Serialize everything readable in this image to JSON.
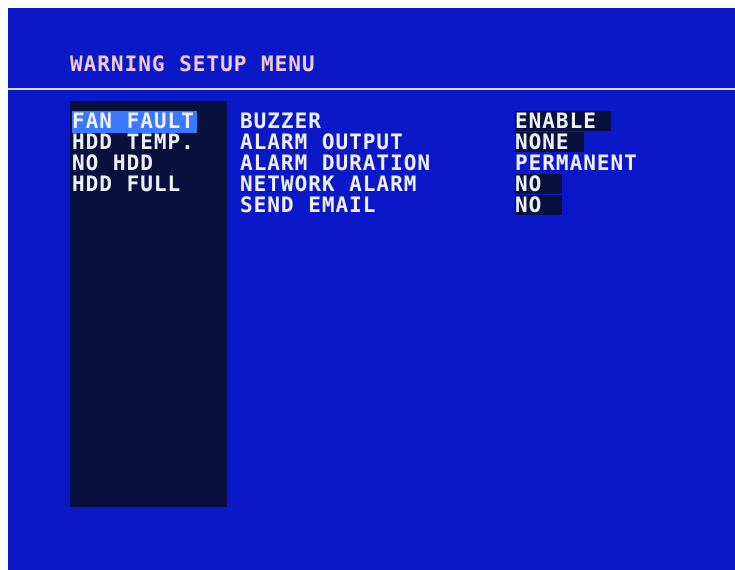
{
  "menu": {
    "title": "WARNING SETUP MENU"
  },
  "warnings": [
    {
      "label": "FAN FAULT",
      "selected": true
    },
    {
      "label": "HDD TEMP.",
      "selected": false
    },
    {
      "label": "NO HDD",
      "selected": false
    },
    {
      "label": "HDD FULL",
      "selected": false
    }
  ],
  "settings": [
    {
      "label": "BUZZER",
      "value": "ENABLE"
    },
    {
      "label": "ALARM OUTPUT",
      "value": "NONE"
    },
    {
      "label": "ALARM DURATION",
      "value": "PERMANENT"
    },
    {
      "label": "NETWORK ALARM",
      "value": "NO"
    },
    {
      "label": "SEND EMAIL",
      "value": "NO"
    }
  ],
  "colors": {
    "screen_background": "#0a18c8",
    "list_panel": "#08103e",
    "selection_highlight": "#3a78ff",
    "title_text": "#f2c8dc",
    "text": "#eef0ff"
  }
}
